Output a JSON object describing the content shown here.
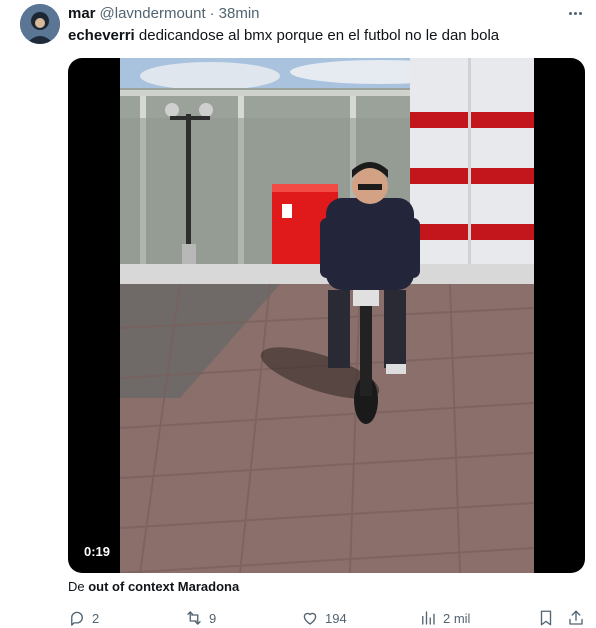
{
  "tweet": {
    "author_name": "mar",
    "author_handle": "@lavndermount",
    "separator": "·",
    "time": "38min",
    "text_bold": "echeverri",
    "text_rest": " dedicandose al bmx porque en el futbol no le dan bola",
    "media": {
      "duration": "0:19"
    },
    "source_prefix": "De ",
    "source_name": "out of context Maradona",
    "actions": {
      "replies": "2",
      "retweets": "9",
      "likes": "194",
      "views": "2 mil"
    },
    "icons": {
      "more": "more-icon",
      "reply": "reply-icon",
      "retweet": "retweet-icon",
      "like": "heart-icon",
      "views": "views-icon",
      "bookmark": "bookmark-icon",
      "share": "share-icon"
    }
  }
}
